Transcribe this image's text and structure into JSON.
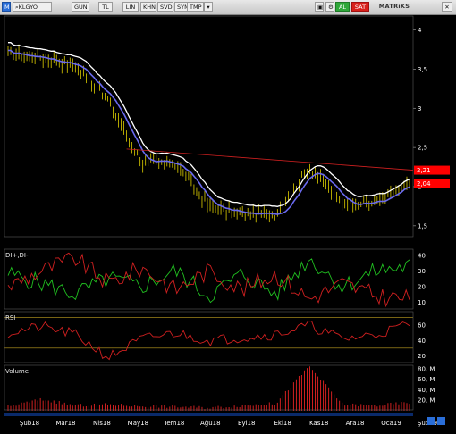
{
  "toolbar": {
    "app_letter": "M",
    "symbol": "KLGYO",
    "buttons": [
      "GUN",
      "TL",
      "LIN",
      "KHN",
      "SVD",
      "SYM",
      "TMP"
    ],
    "alarm_label": "AL",
    "sell_label": "SAT",
    "brand": "MATRiKS",
    "close_glyph": "✕",
    "dropdown_icon": "chevron-down-icon",
    "search_icon": "search-icon",
    "lock_icon": "lock-icon"
  },
  "colors": {
    "background": "#000000",
    "price_bar": "#e0d000",
    "upper_band": "#ffffff",
    "ma": "#6a6af0",
    "trendline": "#d02020",
    "di_plus": "#20c020",
    "di_minus": "#d02020",
    "rsi": "#d02020",
    "volume": "#d02020",
    "price_badge": "#ff0000"
  },
  "price_panel": {
    "y_ticks": [
      "4",
      "3,5",
      "3",
      "2,5",
      "2",
      "1,5"
    ],
    "last_price_red": "2,21",
    "last_price": "2,04"
  },
  "di_panel": {
    "title": "DI+,DI-",
    "y_ticks": [
      "40",
      "30",
      "20",
      "10"
    ]
  },
  "rsi_panel": {
    "title": "RSI",
    "y_ticks": [
      "60",
      "40",
      "20"
    ]
  },
  "volume_panel": {
    "title": "Volume",
    "y_ticks": [
      "80, M",
      "60, M",
      "40, M",
      "20, M"
    ]
  },
  "x_axis": {
    "labels": [
      "Şub18",
      "Mar18",
      "Nis18",
      "May18",
      "Tem18",
      "Ağu18",
      "Eyl18",
      "Eki18",
      "Kas18",
      "Ara18",
      "Oca19",
      "Şub19"
    ]
  },
  "chart_data": [
    {
      "type": "line",
      "title": "KLGYO",
      "ylim": [
        1.35,
        4.2
      ],
      "x": [
        "Şub18",
        "Mar18",
        "Nis18",
        "May18",
        "Haz18",
        "Tem18",
        "Ağu18",
        "Eyl18",
        "Eki18",
        "Kas18",
        "Ara18",
        "Oca19",
        "Şub19"
      ],
      "series": [
        {
          "values": [
            3.7,
            3.65,
            3.55,
            3.1,
            2.3,
            2.3,
            1.75,
            1.65,
            1.65,
            2.25,
            1.8,
            1.8,
            2.04
          ]
        }
      ],
      "annotations": [
        "2,21",
        "2,04"
      ]
    },
    {
      "type": "line",
      "title": "DI+,DI-",
      "ylim": [
        5,
        45
      ],
      "x": [
        "Şub18",
        "Mar18",
        "Nis18",
        "May18",
        "Haz18",
        "Tem18",
        "Ağu18",
        "Eyl18",
        "Eki18",
        "Kas18",
        "Ara18",
        "Oca19",
        "Şub19"
      ],
      "series": [
        {
          "values": [
            28,
            22,
            15,
            25,
            20,
            30,
            14,
            28,
            15,
            38,
            20,
            30,
            33
          ]
        },
        {
          "values": [
            20,
            30,
            38,
            22,
            32,
            18,
            30,
            18,
            28,
            12,
            22,
            14,
            12
          ]
        }
      ]
    },
    {
      "type": "line",
      "title": "RSI",
      "ylim": [
        10,
        80
      ],
      "x": [
        "Şub18",
        "Mar18",
        "Nis18",
        "May18",
        "Haz18",
        "Tem18",
        "Ağu18",
        "Eyl18",
        "Eki18",
        "Kas18",
        "Ara18",
        "Oca19",
        "Şub19"
      ],
      "series": [
        {
          "values": [
            50,
            58,
            48,
            18,
            42,
            50,
            40,
            44,
            48,
            60,
            42,
            48,
            62
          ]
        }
      ]
    },
    {
      "type": "bar",
      "title": "Volume",
      "ylim": [
        0,
        90
      ],
      "categories": [
        "Şub18",
        "Mar18",
        "Nis18",
        "May18",
        "Haz18",
        "Tem18",
        "Ağu18",
        "Eyl18",
        "Eki18",
        "Kas18",
        "Ara18",
        "Oca19",
        "Şub19"
      ],
      "values": [
        8,
        22,
        10,
        12,
        9,
        8,
        6,
        10,
        14,
        85,
        12,
        10,
        16
      ]
    }
  ]
}
